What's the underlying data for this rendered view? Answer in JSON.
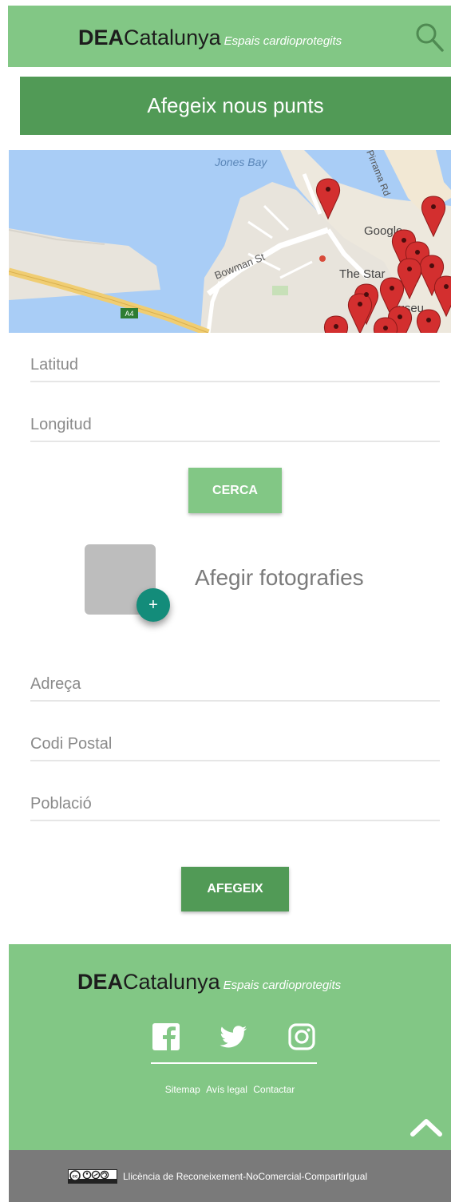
{
  "header": {
    "logo_bold": "DEA",
    "logo_regular": "Catalunya",
    "tagline": "Espais cardioprotegits",
    "search_icon": "search-icon"
  },
  "banner": {
    "title": "Afegeix nous punts"
  },
  "map": {
    "labels": {
      "bay": "Jones Bay",
      "street": "Bowman St",
      "road": "Pirrama Rd",
      "road_badge": "A4",
      "poi_google": "Google",
      "poi_star": "The Star",
      "poi_museum": "Museu"
    },
    "colors": {
      "water": "#a9cdf6",
      "land": "#e8e4dc",
      "marker": "#d32f2f"
    }
  },
  "form": {
    "latitude_placeholder": "Latitud",
    "longitude_placeholder": "Longitud",
    "search_button": "CERCA",
    "photo_label": "Afegir fotografies",
    "address_placeholder": "Adreça",
    "postal_code_placeholder": "Codi Postal",
    "town_placeholder": "Població",
    "submit_button": "AFEGEIX"
  },
  "footer": {
    "logo_bold": "DEA",
    "logo_regular": "Catalunya",
    "tagline": "Espais cardioprotegits",
    "social_icons": [
      "facebook-icon",
      "twitter-icon",
      "instagram-icon"
    ],
    "links": [
      "Sitemap",
      "Avís legal",
      "Contactar"
    ],
    "back_to_top_icon": "chevron-up-icon"
  },
  "license": {
    "text": "Llicència de Reconeixement-NoComercial-CompartirIgual",
    "badge_icon": "creative-commons-icon"
  },
  "colors": {
    "primary_light": "#82c785",
    "primary_dark": "#519a56",
    "fab": "#138c7a",
    "bottom_bar": "#7a7a7a"
  }
}
